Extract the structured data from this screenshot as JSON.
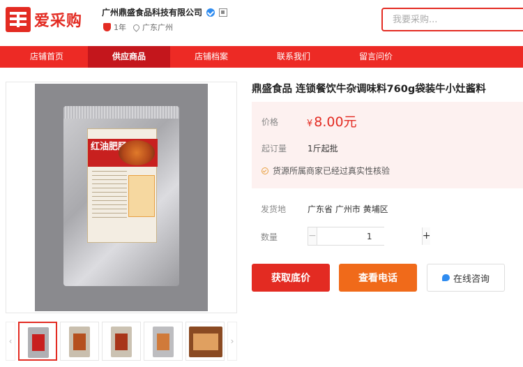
{
  "header": {
    "logo_text": "爱采购",
    "company_name": "广州鼎盛食品科技有限公司",
    "years": "1年",
    "location": "广东广州",
    "search_placeholder": "我要采购..."
  },
  "nav": {
    "items": [
      "店铺首页",
      "供应商品",
      "店铺档案",
      "联系我们",
      "留言问价"
    ],
    "active": "供应商品"
  },
  "product": {
    "title": "鼎盛食品 连锁餐饮牛杂调味料760g袋装牛小灶酱料",
    "package_label": "红油肥肠",
    "price_label": "价格",
    "currency": "¥",
    "price": "8.00元",
    "moq_label": "起订量",
    "moq": "1斤起批",
    "notice": "货源所属商家已经过真实性核验",
    "ship_label": "发货地",
    "ship_from": "广东省 广州市 黄埔区",
    "qty_label": "数量",
    "qty_value": "1",
    "qty_minus": "−",
    "qty_plus": "+"
  },
  "actions": {
    "lowest_price": "获取底价",
    "view_phone": "查看电话",
    "online_chat": "在线咨询"
  },
  "gallery": {
    "thumbnail_count": 5,
    "active_index": 0,
    "prev_arrow": "‹",
    "next_arrow": "›"
  },
  "colors": {
    "brand_red": "#e32b22",
    "nav_red": "#ed2a25",
    "nav_active": "#c4161c",
    "orange": "#f06a1a",
    "verified_blue": "#2f8cf0"
  }
}
